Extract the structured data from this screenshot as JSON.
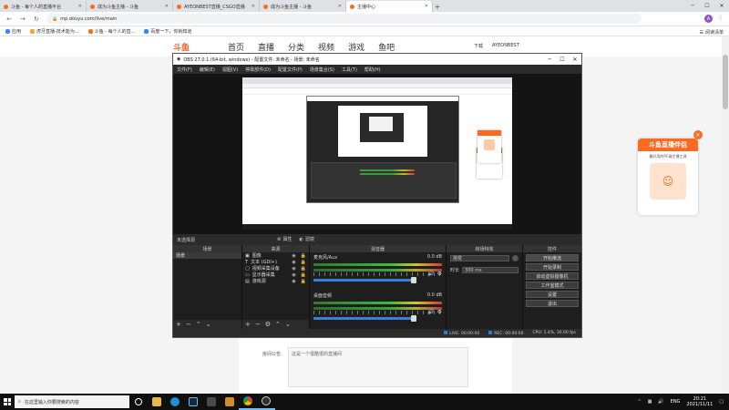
{
  "browser": {
    "tabs": [
      {
        "label": "斗鱼 - 每个人的直播平台",
        "color": "#ff6a22",
        "active": false
      },
      {
        "label": "成为斗鱼主播 - 斗鱼",
        "color": "#ff6a22",
        "active": false
      },
      {
        "label": "AYEONBEST直播_CSGO直播",
        "color": "#ff6a22",
        "active": false
      },
      {
        "label": "成为斗鱼主播 - 斗鱼",
        "color": "#ff6a22",
        "active": false
      },
      {
        "label": "主播中心",
        "color": "#ff6a22",
        "active": true
      }
    ],
    "new_tab": "+",
    "url": "mp.douyu.com/live/main",
    "profile_initial": "A",
    "bookmarks": [
      {
        "label": "应用",
        "color": "#4285f4"
      },
      {
        "label": "虎牙直播-技术能为...",
        "color": "#f5a623"
      },
      {
        "label": "斗鱼 - 每个人的直...",
        "color": "#ff6a22"
      },
      {
        "label": "百度一下，你就知道",
        "color": "#3388ff"
      }
    ],
    "reading_list": "阅读清单"
  },
  "douyu": {
    "logo": "斗鱼",
    "nav": [
      "首页",
      "直播",
      "分类",
      "视频",
      "游戏",
      "鱼吧"
    ],
    "user": [
      "下载",
      "AYEONBEST"
    ],
    "notice_label": "房间公告:",
    "notice_text": "这是一个很酷很的直播间",
    "promo_title": "斗鱼直播伴侣",
    "promo_sub": "最好用的PC端主播工具"
  },
  "obs": {
    "title": "OBS 27.0.1 (64-bit, windows) - 配置文件: 未命名 - 场景: 未命名",
    "menu": [
      "文件(F)",
      "编辑(E)",
      "视图(V)",
      "停靠部件(D)",
      "配置文件(P)",
      "场景集合(S)",
      "工具(T)",
      "帮助(H)"
    ],
    "scene_bar_label": "未选择源",
    "properties_label": "属性",
    "filters_label": "滤镜",
    "panels": {
      "scenes": "场景",
      "sources": "来源",
      "mixer": "混音器",
      "transitions": "转场特效",
      "controls": "控件"
    },
    "scenes": [
      "场景"
    ],
    "sources": [
      {
        "label": "图像",
        "icon": "▣"
      },
      {
        "label": "文本 (GDI+)",
        "icon": "T"
      },
      {
        "label": "视频采集设备",
        "icon": "▢"
      },
      {
        "label": "显示器采集",
        "icon": "▭"
      },
      {
        "label": "游戏源",
        "icon": "▤"
      }
    ],
    "mixer": [
      {
        "name": "麦克风/Aux",
        "db": "0.0 dB"
      },
      {
        "name": "桌面音频",
        "db": "0.0 dB"
      }
    ],
    "transition": {
      "type": "渐变",
      "duration_label": "时长",
      "duration": "300 ms"
    },
    "controls": [
      "开始推流",
      "开始录制",
      "启动虚拟摄像机",
      "工作室模式",
      "设置",
      "退出"
    ],
    "status": {
      "live": "LIVE: 00:00:00",
      "rec": "REC: 00:00:00",
      "cpu": "CPU: 1.4%, 30.00 fps"
    }
  },
  "taskbar": {
    "search_placeholder": "在这里输入你要搜索的内容",
    "lang": "ENG",
    "time": "20:21",
    "date": "2021/11/11"
  }
}
